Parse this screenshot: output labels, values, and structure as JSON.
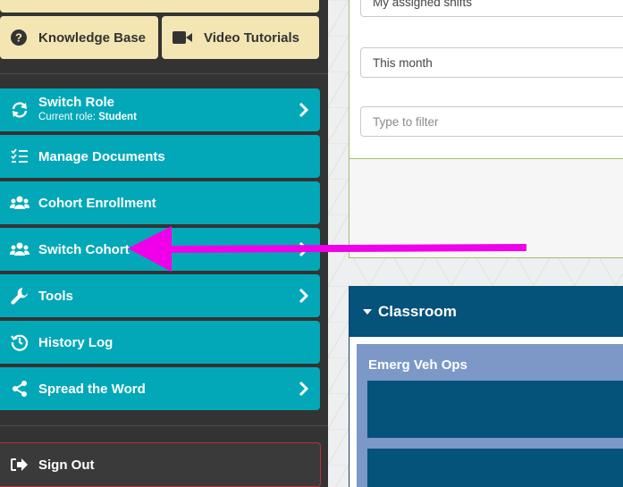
{
  "sidebar": {
    "knowledge_base": {
      "label": "Knowledge Base",
      "icon": "question-circle-icon"
    },
    "video_tutorials": {
      "label": "Video Tutorials",
      "icon": "video-camera-icon"
    },
    "items": [
      {
        "label": "Switch Role",
        "sub_prefix": "Current role: ",
        "sub_value": "Student",
        "icon": "refresh-icon",
        "has_chevron": true
      },
      {
        "label": "Manage Documents",
        "icon": "checklist-icon",
        "has_chevron": false
      },
      {
        "label": "Cohort Enrollment",
        "icon": "users-icon",
        "has_chevron": false
      },
      {
        "label": "Switch Cohort",
        "icon": "users-icon",
        "has_chevron": true
      },
      {
        "label": "Tools",
        "icon": "wrench-icon",
        "has_chevron": true
      },
      {
        "label": "History Log",
        "icon": "history-icon",
        "has_chevron": false
      },
      {
        "label": "Spread the Word",
        "icon": "share-icon",
        "has_chevron": true
      }
    ],
    "sign_out": {
      "label": "Sign Out",
      "icon": "sign-out-icon"
    }
  },
  "filters": {
    "shifts_value": "My assigned shifts",
    "period_value": "This month",
    "filter_placeholder": "Type to filter"
  },
  "classroom": {
    "title": "Classroom",
    "course_name": "Emerg Veh Ops"
  },
  "colors": {
    "sidebar_bg": "#333333",
    "nav_teal": "#02a8b8",
    "yellow_button": "#f3e6b3",
    "classroom_header": "#05527a",
    "course_card": "#7b98c7",
    "annotation_arrow": "#f000e8",
    "sign_out_border": "#b8323a"
  }
}
